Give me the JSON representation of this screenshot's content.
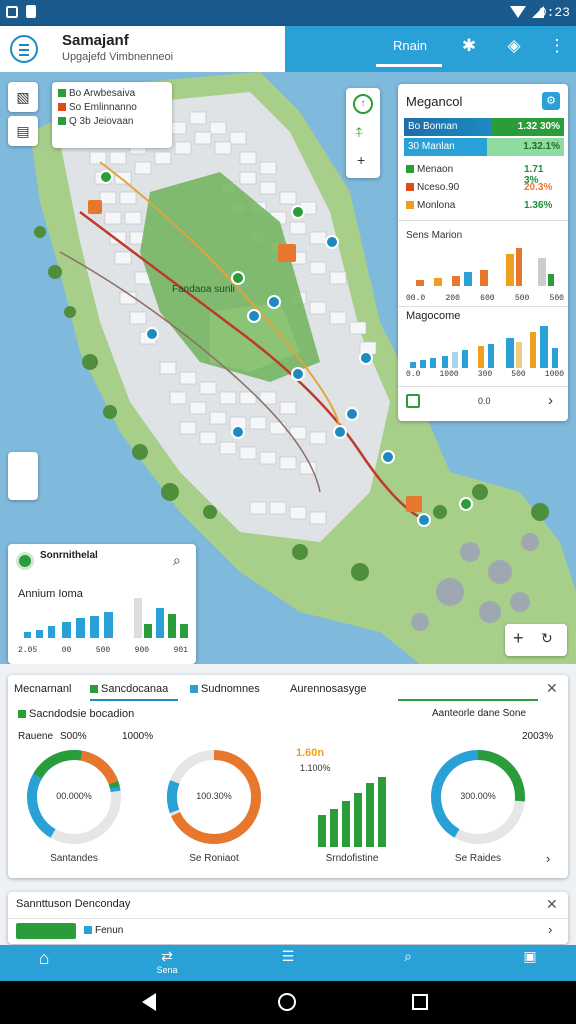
{
  "status": {
    "time": "0:23"
  },
  "app": {
    "title": "Samajanf",
    "subtitle": "Upgajefd Vimbnenneoi",
    "tab": "Rnain"
  },
  "map": {
    "legend": [
      {
        "text": "Bo Arwbesaiva",
        "color": "#2a9d3a"
      },
      {
        "text": "So Emlinnanno",
        "color": "#e04a1a"
      },
      {
        "text": "Q 3b Jeiovaan",
        "color": "#2a9d3a"
      }
    ],
    "park_label": "Fandaoa sunli",
    "zoom_in": "+",
    "compass_icon": "compass-icon"
  },
  "right_panel": {
    "title": "Megancol",
    "bars": [
      {
        "label": "Bo Bonnan",
        "value": "1.32 30%",
        "color": "#1d8bc2"
      },
      {
        "label": "30 Manlan",
        "value": "1.32.1%",
        "color": "#29a0d6"
      }
    ],
    "legend": [
      {
        "label": "Menaon",
        "value": "1.71 3%",
        "color": "#2a9d3a"
      },
      {
        "label": "Nceso.90",
        "value": "20.3%",
        "color": "#e04a1a"
      },
      {
        "label": "Monlona",
        "value": "1.36%",
        "color": "#f0a020"
      }
    ],
    "chart1_title": "Sens Marion",
    "chart1_ticks": [
      "00.0",
      "200",
      "600",
      "500",
      "500"
    ],
    "chart2_title": "Magocome",
    "chart2_ticks": [
      "0.0",
      "1000",
      "300",
      "500",
      "1000"
    ],
    "footer": "0.0"
  },
  "left_card": {
    "title": "Sonrnithelal",
    "subtitle": "Annium Ioma",
    "ticks": [
      "2.05",
      "00",
      "500",
      "900",
      "901"
    ]
  },
  "bottom": {
    "tabs": [
      "Mecnarnanl",
      "Sancdocanaa",
      "Sudnomnes",
      "Aurennosasyge"
    ],
    "section": "Sacndodsie bocadion",
    "right_title": "Aanteorle dane Sone",
    "label_left": "Rauene",
    "val1": "S00%",
    "val2": "1000%",
    "val3": "2003%",
    "bar_top": "1.60n",
    "bar_sub": "1.100%",
    "donuts": [
      {
        "center": "00.000%",
        "label": "Santandes"
      },
      {
        "center": "100.30%",
        "label": "Se Roniaot"
      },
      {
        "center": "300.00%",
        "label": "Se Raides"
      }
    ],
    "bar_label": "Srndofistine"
  },
  "bottom2": {
    "title": "Sannttuson Denconday",
    "chip1": "",
    "chip2": "Fenun"
  },
  "nav": [
    "Home",
    "Sena",
    "Lists",
    "Search",
    "Bonk"
  ]
}
